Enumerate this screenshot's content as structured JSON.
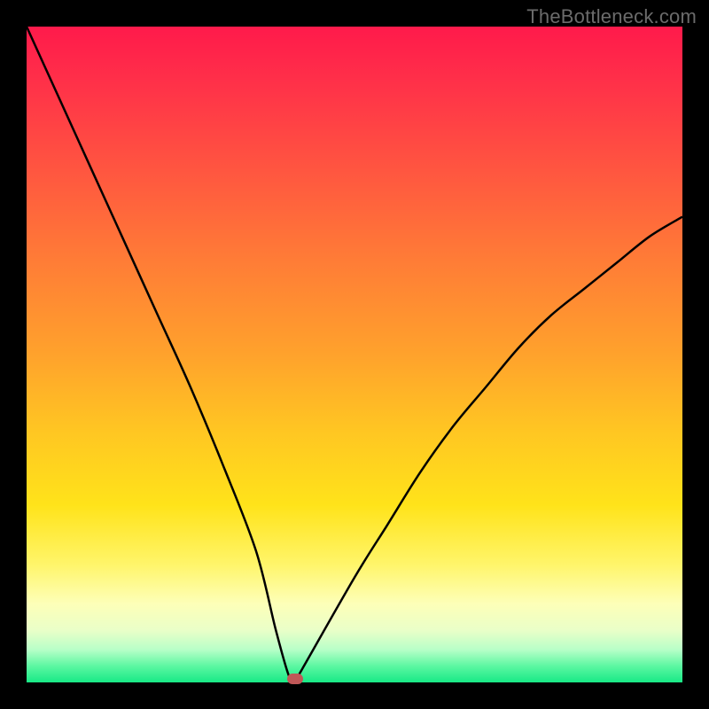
{
  "watermark": "TheBottleneck.com",
  "chart_data": {
    "type": "line",
    "title": "",
    "xlabel": "",
    "ylabel": "",
    "xlim": [
      0,
      100
    ],
    "ylim": [
      0,
      100
    ],
    "grid": false,
    "legend": false,
    "colors": {
      "curve": "#000000",
      "marker": "#c05858",
      "gradient_top": "#ff1a4b",
      "gradient_bottom": "#18e986"
    },
    "series": [
      {
        "name": "bottleneck-curve",
        "x": [
          0,
          5,
          10,
          15,
          20,
          25,
          30,
          35,
          38,
          40,
          41,
          42,
          50,
          55,
          60,
          65,
          70,
          75,
          80,
          85,
          90,
          95,
          100
        ],
        "values": [
          100,
          89,
          78,
          67,
          56,
          45,
          33,
          20,
          8,
          1,
          0.5,
          2,
          16,
          24,
          32,
          39,
          45,
          51,
          56,
          60,
          64,
          68,
          71
        ]
      }
    ],
    "marker": {
      "x": 41,
      "y": 0.5
    }
  }
}
